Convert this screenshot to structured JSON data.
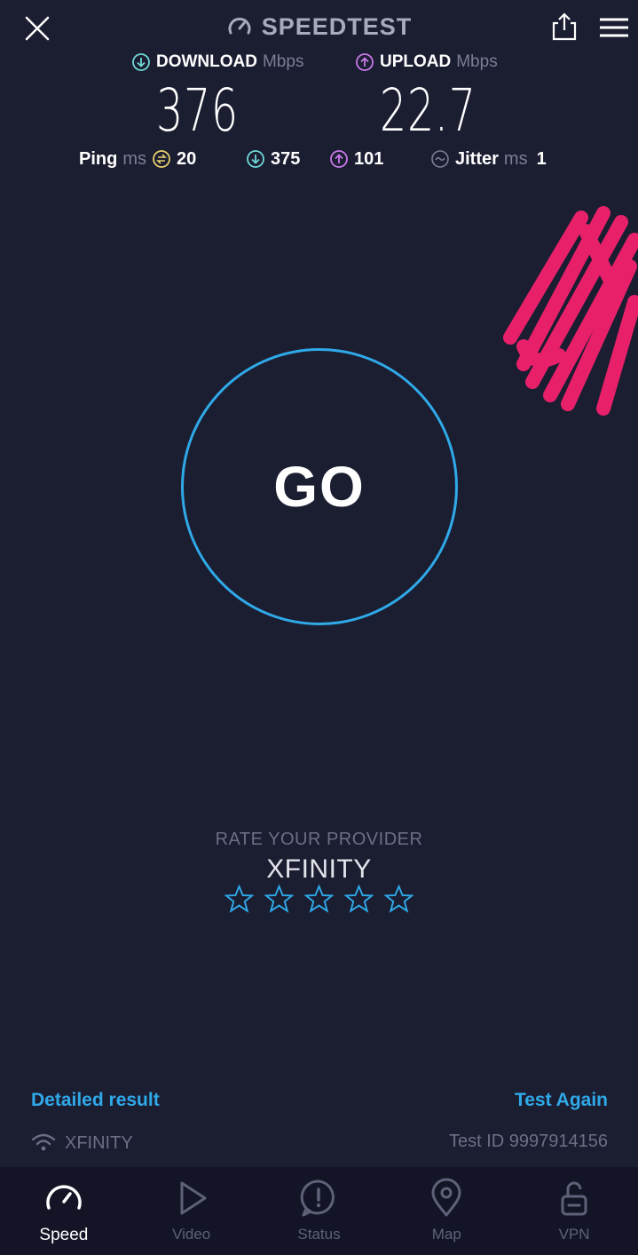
{
  "header": {
    "title": "SPEEDTEST",
    "icons": {
      "close": "close-icon",
      "logo": "speedometer-icon",
      "share": "share-icon",
      "menu": "hamburger-menu-icon"
    }
  },
  "results": {
    "download": {
      "label": "DOWNLOAD",
      "unit": "Mbps",
      "value": "376"
    },
    "upload": {
      "label": "UPLOAD",
      "unit": "Mbps",
      "value": "22.7"
    },
    "ping": {
      "label": "Ping",
      "unit": "ms",
      "idle": "20",
      "download": "375",
      "upload": "101"
    },
    "jitter": {
      "label": "Jitter",
      "unit": "ms",
      "value": "1"
    }
  },
  "go_button": {
    "label": "GO"
  },
  "rating": {
    "title": "RATE YOUR PROVIDER",
    "provider": "XFINITY",
    "stars_max": 5,
    "stars_selected": 0
  },
  "footer": {
    "detailed_result": "Detailed result",
    "test_again": "Test Again",
    "network_name": "XFINITY",
    "test_id": "Test ID 9997914156"
  },
  "nav": {
    "items": [
      {
        "label": "Speed",
        "icon": "speedometer-icon",
        "active": true
      },
      {
        "label": "Video",
        "icon": "play-icon",
        "active": false
      },
      {
        "label": "Status",
        "icon": "alert-bubble-icon",
        "active": false
      },
      {
        "label": "Map",
        "icon": "map-pin-icon",
        "active": false
      },
      {
        "label": "VPN",
        "icon": "lock-open-icon",
        "active": false
      }
    ]
  },
  "colors": {
    "background": "#1b1d31",
    "accent": "#2fa9e8",
    "download": "#6fd8d8",
    "upload": "#c879e8",
    "ping": "#e8d06a",
    "scribble": "#e8206a"
  }
}
